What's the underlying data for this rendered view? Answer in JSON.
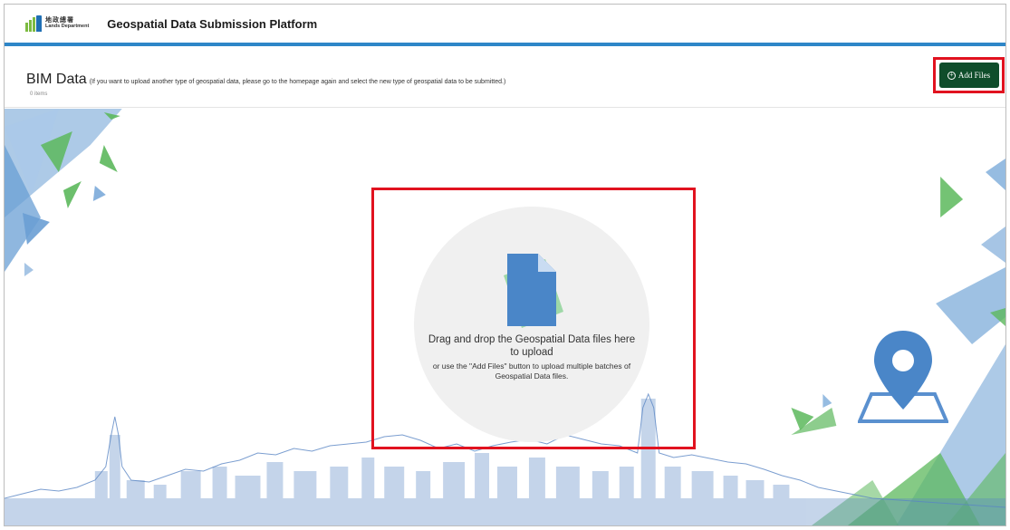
{
  "header": {
    "logo_cn": "地政總署",
    "logo_en": "Lands Department",
    "title": "Geospatial Data Submission Platform"
  },
  "toolbar": {
    "section_name": "BIM Data",
    "section_note": "(If you want to upload another type of geospatial data, please go to the homepage again and select the new type of geospatial data to be submitted.)",
    "item_count": "0 items",
    "add_files_label": "Add Files"
  },
  "dropzone": {
    "main_text": "Drag and drop the Geospatial Data files here to upload",
    "sub_text": "or use the \"Add Files\" button to upload multiple batches of Geospatial Data files."
  },
  "icons": [
    "lands-department-logo",
    "plus-circle-icon",
    "file-icon",
    "location-pin-icon"
  ],
  "colors": {
    "header_accent": "#2e86c8",
    "button_bg": "#0f4d2b",
    "highlight_border": "#e1121f",
    "decor_blue": "#6a9fd4",
    "decor_green": "#5cb85c"
  }
}
